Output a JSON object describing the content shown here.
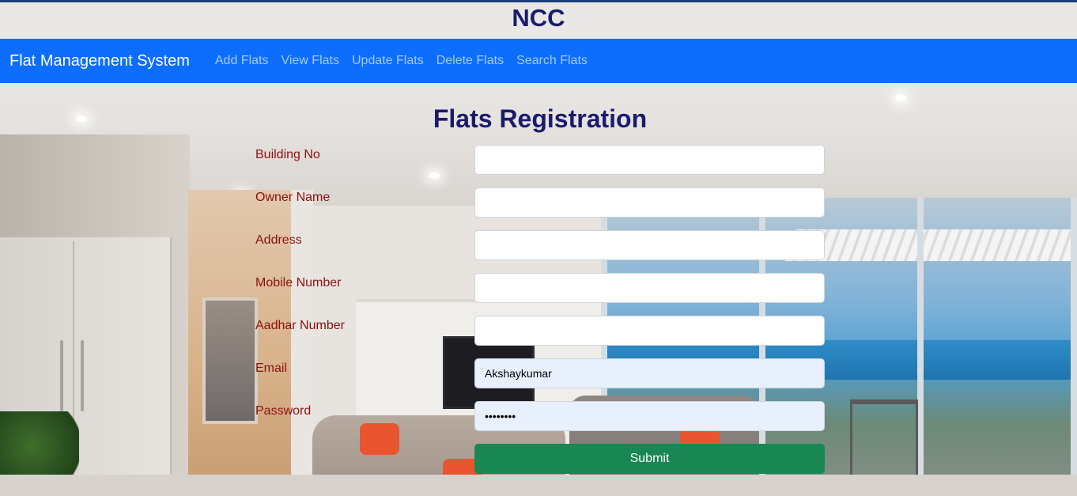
{
  "header": {
    "title": "NCC"
  },
  "navbar": {
    "brand": "Flat Management System",
    "links": [
      "Add Flats",
      "View Flats",
      "Update Flats",
      "Delete Flats",
      "Search Flats"
    ]
  },
  "form": {
    "title": "Flats Registration",
    "fields": [
      {
        "label": "Building No",
        "value": ""
      },
      {
        "label": "Owner Name",
        "value": ""
      },
      {
        "label": "Address",
        "value": ""
      },
      {
        "label": "Mobile Number",
        "value": ""
      },
      {
        "label": "Aadhar Number",
        "value": ""
      },
      {
        "label": "Email",
        "value": "Akshaykumar"
      },
      {
        "label": "Password",
        "value": "••••••••"
      }
    ],
    "submit_label": "Submit"
  },
  "colors": {
    "navbar": "#0d6efd",
    "title": "#1b1b6b",
    "label": "#8b1010",
    "submit": "#198754",
    "autofill": "#e8f0fe"
  }
}
